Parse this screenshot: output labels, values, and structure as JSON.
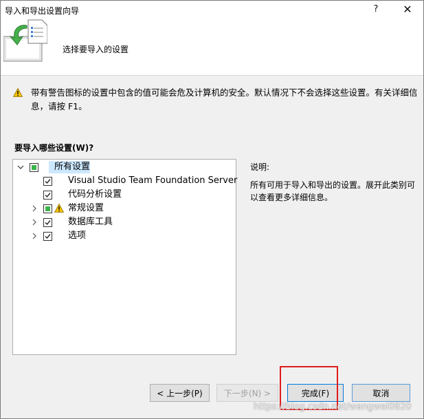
{
  "window": {
    "title": "导入和导出设置向导",
    "help_symbol": "?",
    "close_symbol": "✕"
  },
  "header": {
    "title": "选择要导入的设置"
  },
  "warning": {
    "text": "带有警告图标的设置中包含的值可能会危及计算机的安全。默认情况下不会选择这些设置。有关详细信息，请按 F1。"
  },
  "question": {
    "label": "要导入哪些设置(W)?"
  },
  "tree": {
    "root": {
      "label": "所有设置",
      "state": "partial",
      "expanded": true
    },
    "children": [
      {
        "label": "Visual Studio Team Foundation Server",
        "state": "checked",
        "expandable": false,
        "warning": false
      },
      {
        "label": "代码分析设置",
        "state": "checked",
        "expandable": false,
        "warning": false
      },
      {
        "label": "常规设置",
        "state": "partial",
        "expandable": true,
        "warning": true
      },
      {
        "label": "数据库工具",
        "state": "checked",
        "expandable": true,
        "warning": false
      },
      {
        "label": "选项",
        "state": "checked",
        "expandable": true,
        "warning": false
      }
    ]
  },
  "description": {
    "heading": "说明:",
    "body": "所有可用于导入和导出的设置。展开此类别可以查看更多详细信息。"
  },
  "buttons": {
    "back": "< 上一步(P)",
    "next": "下一步(N) >",
    "finish": "完成(F)",
    "cancel": "取消"
  },
  "watermark": "https://blog.csdn.net/wangwei0820",
  "colors": {
    "check_green": "#3bb34a",
    "selection": "#cce8ff",
    "highlight_box": "#e01b1b",
    "warning_yellow": "#f5c400"
  }
}
